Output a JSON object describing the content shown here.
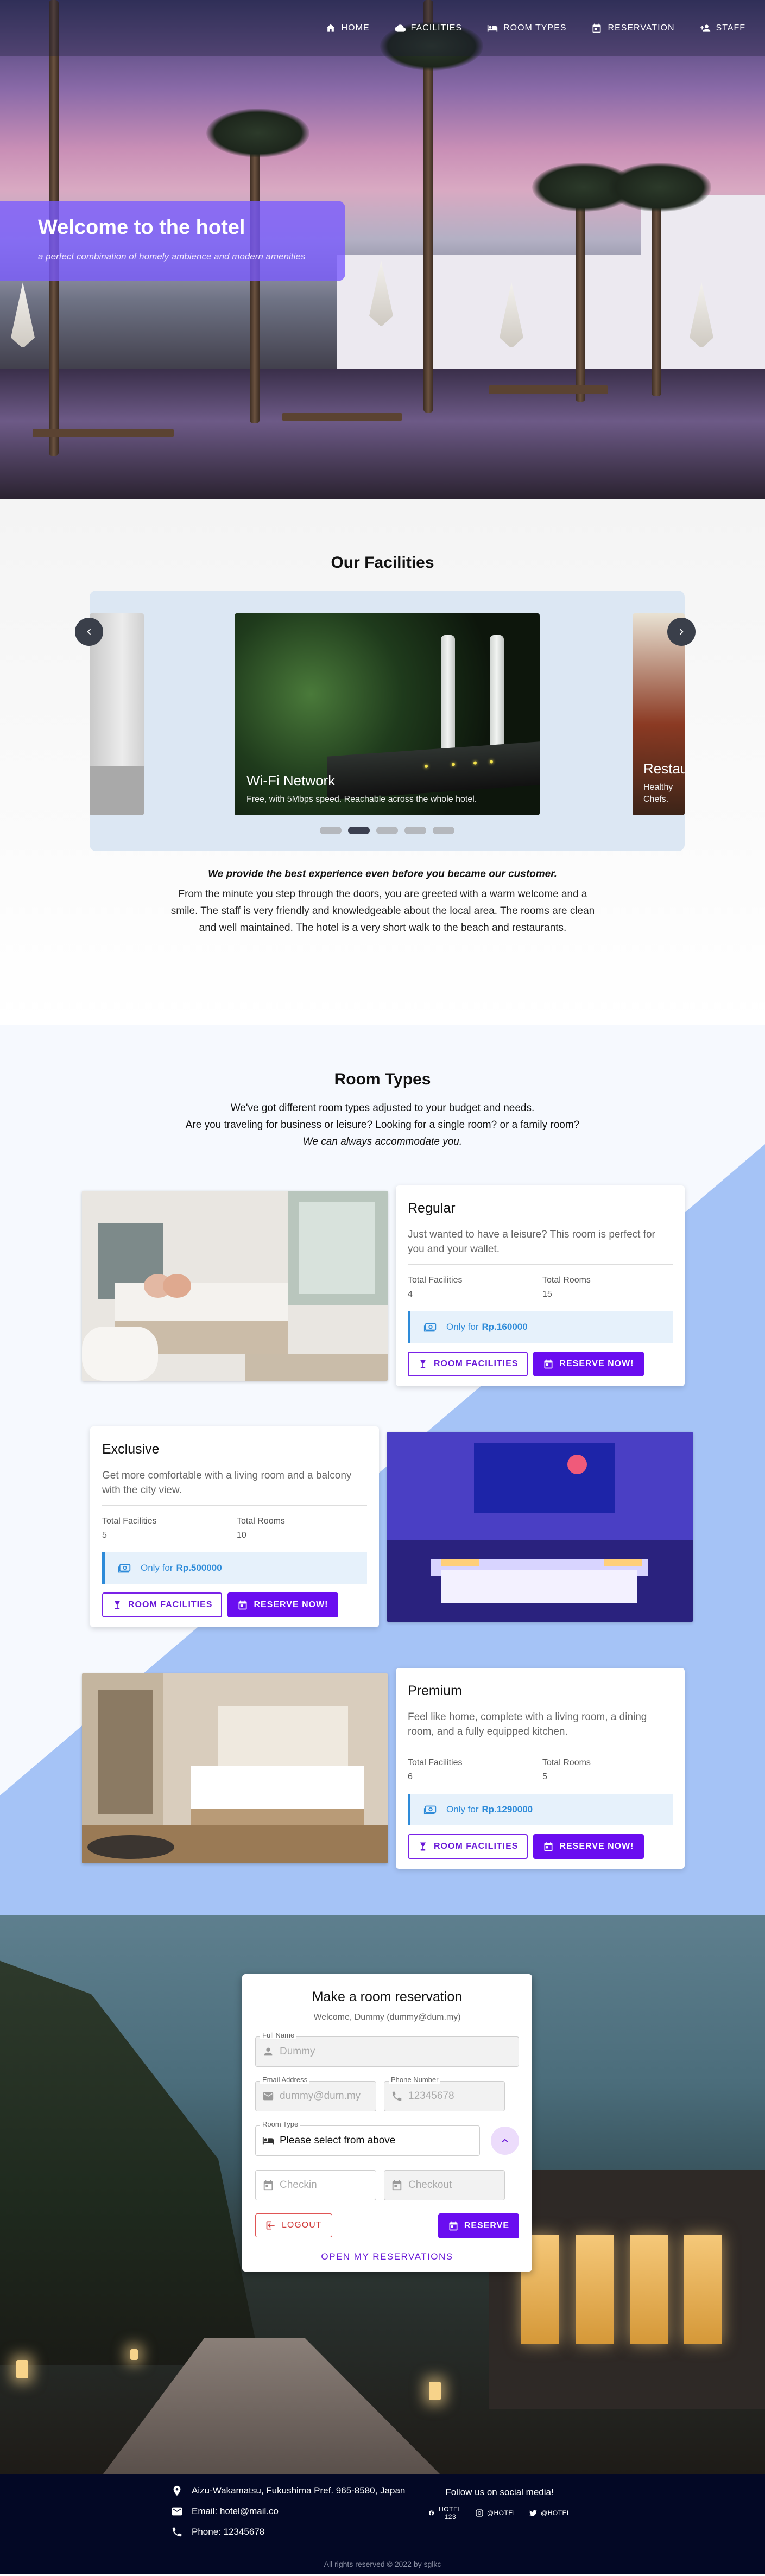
{
  "nav": {
    "items": [
      {
        "label": "HOME",
        "icon": "home-icon"
      },
      {
        "label": "FACILITIES",
        "icon": "cloud-icon"
      },
      {
        "label": "ROOM TYPES",
        "icon": "bed-icon"
      },
      {
        "label": "RESERVATION",
        "icon": "calendar-icon"
      },
      {
        "label": "STAFF",
        "icon": "person-add-icon"
      }
    ]
  },
  "hero": {
    "title": "Welcome to the hotel",
    "subtitle": "a perfect combination of homely ambience and modern amenities"
  },
  "facilities": {
    "title": "Our Facilities",
    "slides": [
      {
        "title": "Wi-Fi Network",
        "text": "Free, with 5Mbps speed. Reachable across the whole hotel."
      },
      {
        "title": "Restau",
        "text": "Healthy",
        "text2": "Chefs."
      }
    ],
    "tagline": "We provide the best experience even before you became our customer.",
    "description": "From the minute you step through the doors, you are greeted with a warm welcome and a smile. The staff is very friendly and knowledgeable about the local area. The rooms are clean and well maintained. The hotel is a very short walk to the beach and restaurants."
  },
  "rooms": {
    "title": "Room Types",
    "intro1": "We've got different room types adjusted to your budget and needs.",
    "intro2": "Are you traveling for business or leisure? Looking for a single room? or a family room?",
    "intro3": "We can always accommodate you.",
    "labels": {
      "total_facilities": "Total Facilities",
      "total_rooms": "Total Rooms",
      "only_for": "Only for",
      "facilities_btn": "ROOM FACILITIES",
      "reserve_btn": "RESERVE NOW!"
    },
    "items": [
      {
        "name": "Regular",
        "desc": "Just wanted to have a leisure? This room is perfect for you and your wallet.",
        "facilities": "4",
        "rooms": "15",
        "price": "Rp.160000"
      },
      {
        "name": "Exclusive",
        "desc": "Get more comfortable with a living room and a balcony with the city view.",
        "facilities": "5",
        "rooms": "10",
        "price": "Rp.500000"
      },
      {
        "name": "Premium",
        "desc": "Feel like home, complete with a living room, a dining room, and a fully equipped kitchen.",
        "facilities": "6",
        "rooms": "5",
        "price": "Rp.1290000"
      }
    ]
  },
  "reservation": {
    "title": "Make a room reservation",
    "welcome": "Welcome, Dummy (dummy@dum.my)",
    "full_name_label": "Full Name",
    "full_name": "Dummy",
    "email_label": "Email Address",
    "email": "dummy@dum.my",
    "phone_label": "Phone Number",
    "phone": "12345678",
    "room_type_label": "Room Type",
    "room_type": "Please select from above",
    "checkin": "Checkin",
    "checkout": "Checkout",
    "logout": "LOGOUT",
    "reserve": "RESERVE",
    "open_link": "OPEN MY RESERVATIONS"
  },
  "footer": {
    "address": "Aizu-Wakamatsu, Fukushima Pref. 965-8580, Japan",
    "email": "Email: hotel@mail.co",
    "phone": "Phone: 12345678",
    "follow": "Follow us on social media!",
    "socials": [
      "HOTEL 123",
      "@HOTEL",
      "@HOTEL"
    ],
    "copyright": "All rights reserved © 2022 by sglkc"
  },
  "colors": {
    "accent": "#6a0df0",
    "hero_banner": "#785aff",
    "footer": "#030825",
    "price": "#2e8bd9"
  }
}
